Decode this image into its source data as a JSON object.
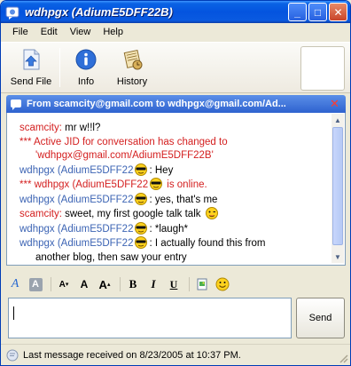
{
  "window": {
    "title": "wdhpgx (AdiumE5DFF22B)",
    "minimize_glyph": "_",
    "maximize_glyph": "□",
    "close_glyph": "✕"
  },
  "menu": {
    "items": [
      "File",
      "Edit",
      "View",
      "Help"
    ]
  },
  "toolbar": {
    "send_file": "Send File",
    "info": "Info",
    "history": "History"
  },
  "conversation": {
    "header": "From scamcity@gmail.com to wdhpgx@gmail.com/Ad...",
    "close_glyph": "✕"
  },
  "messages": [
    {
      "sender": "scamcity:",
      "text": " mr w!!l?"
    },
    {
      "sender": "",
      "system": "*** Active JID for conversation has changed to",
      "cont": "'wdhpgx@gmail.com/AdiumE5DFF22B'"
    },
    {
      "sender": "wdhpgx (AdiumE5DFF22",
      "text": ": Hey",
      "smiley": "cool-icon"
    },
    {
      "sender": "",
      "system": "*** wdhpgx (AdiumE5DFF22",
      "system_tail": " is online.",
      "smiley": "cool-icon"
    },
    {
      "sender": "wdhpgx (AdiumE5DFF22",
      "text": ": yes, that's me",
      "smiley": "cool-icon"
    },
    {
      "sender": "scamcity:",
      "text": " sweet, my first google talk talk ",
      "smiley": "wink-icon"
    },
    {
      "sender": "wdhpgx (AdiumE5DFF22",
      "text": ": *laugh*",
      "smiley": "cool-icon"
    },
    {
      "sender": "wdhpgx (AdiumE5DFF22",
      "text": ": I actually found this from",
      "cont": "another blog, then saw your entry",
      "smiley": "cool-icon"
    }
  ],
  "format": {
    "font_a": "A",
    "size_down": "A",
    "size_normal": "A",
    "size_up": "A",
    "bold": "B",
    "italic": "I",
    "underline": "U"
  },
  "input": {
    "value": "",
    "send_label": "Send"
  },
  "status": {
    "text": "Last message received on 8/23/2005 at 10:37 PM."
  },
  "colors": {
    "title_blue": "#0454df",
    "sender_red": "#d42020",
    "sender_blue": "#3c64b4"
  }
}
